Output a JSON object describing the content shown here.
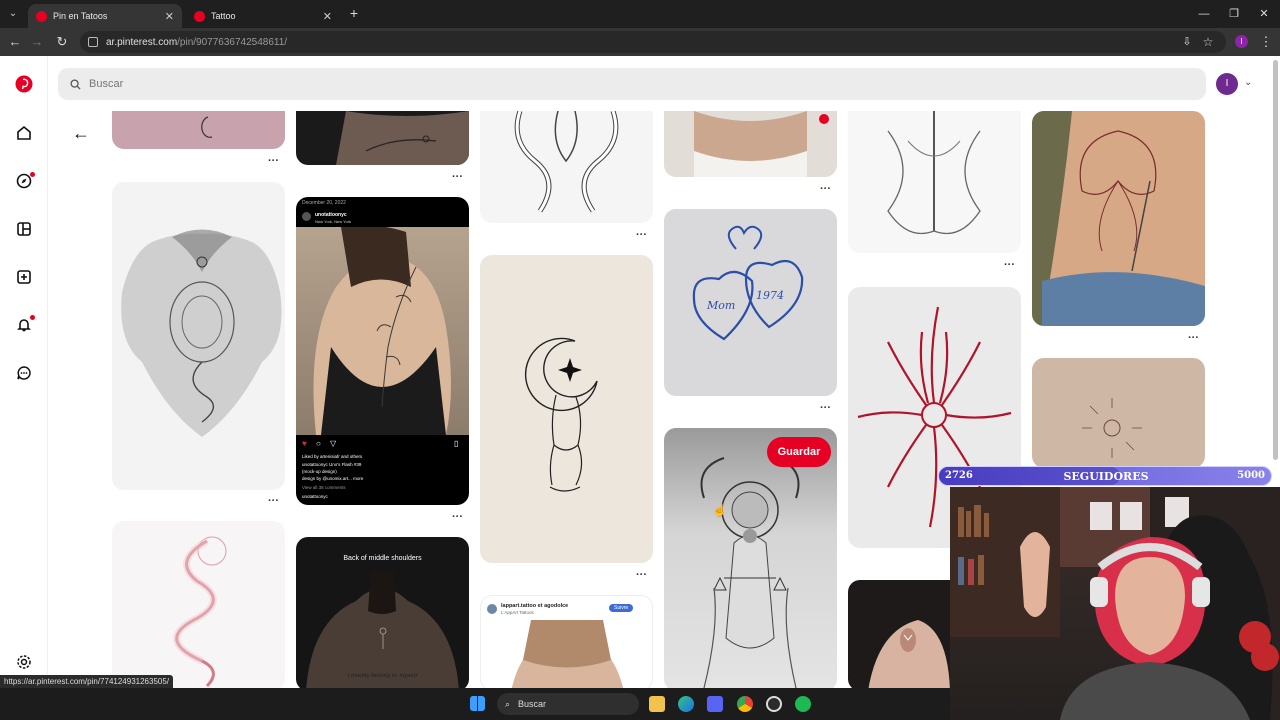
{
  "browser": {
    "tabs": [
      {
        "title": "Pin en Tatoos",
        "active": true
      },
      {
        "title": "Tattoo",
        "active": false
      }
    ],
    "url_host": "ar.pinterest.com",
    "url_path": "/pin/907763674254861​1/",
    "status_url": "https://ar.pinterest.com/pin/774124931263505/"
  },
  "search": {
    "placeholder": "Buscar"
  },
  "profile": {
    "initial": "I"
  },
  "pin_overlay": {
    "save_label": "Guardar"
  },
  "pins": {
    "insta_post": {
      "date": "December 20, 2022",
      "account": "unotattoonyc",
      "location": "New York, New York",
      "likes": "Liked by artenisiafr and others",
      "caption1": "unotattoonyc Uno's Flash #39",
      "caption2": "(mock-up design)",
      "caption3": "design by @unomix.art... more",
      "comments": "View all 38 comments"
    },
    "shoulders_title": "Back of middle shoulders",
    "shoulders_tattoo_text": "i deeply belong to myself",
    "lappart_account": "lappart.tattoo et agodolce",
    "lappart_sub": "L'AppArt Tattoos",
    "lappart_follow": "Suivre",
    "heart_names": [
      "Mom",
      "1974"
    ]
  },
  "stream": {
    "followers_current": "2726",
    "followers_label": "SEGUIDORES",
    "followers_goal": "5000",
    "progress": 0.545
  },
  "taskbar": {
    "search_label": "Buscar"
  }
}
